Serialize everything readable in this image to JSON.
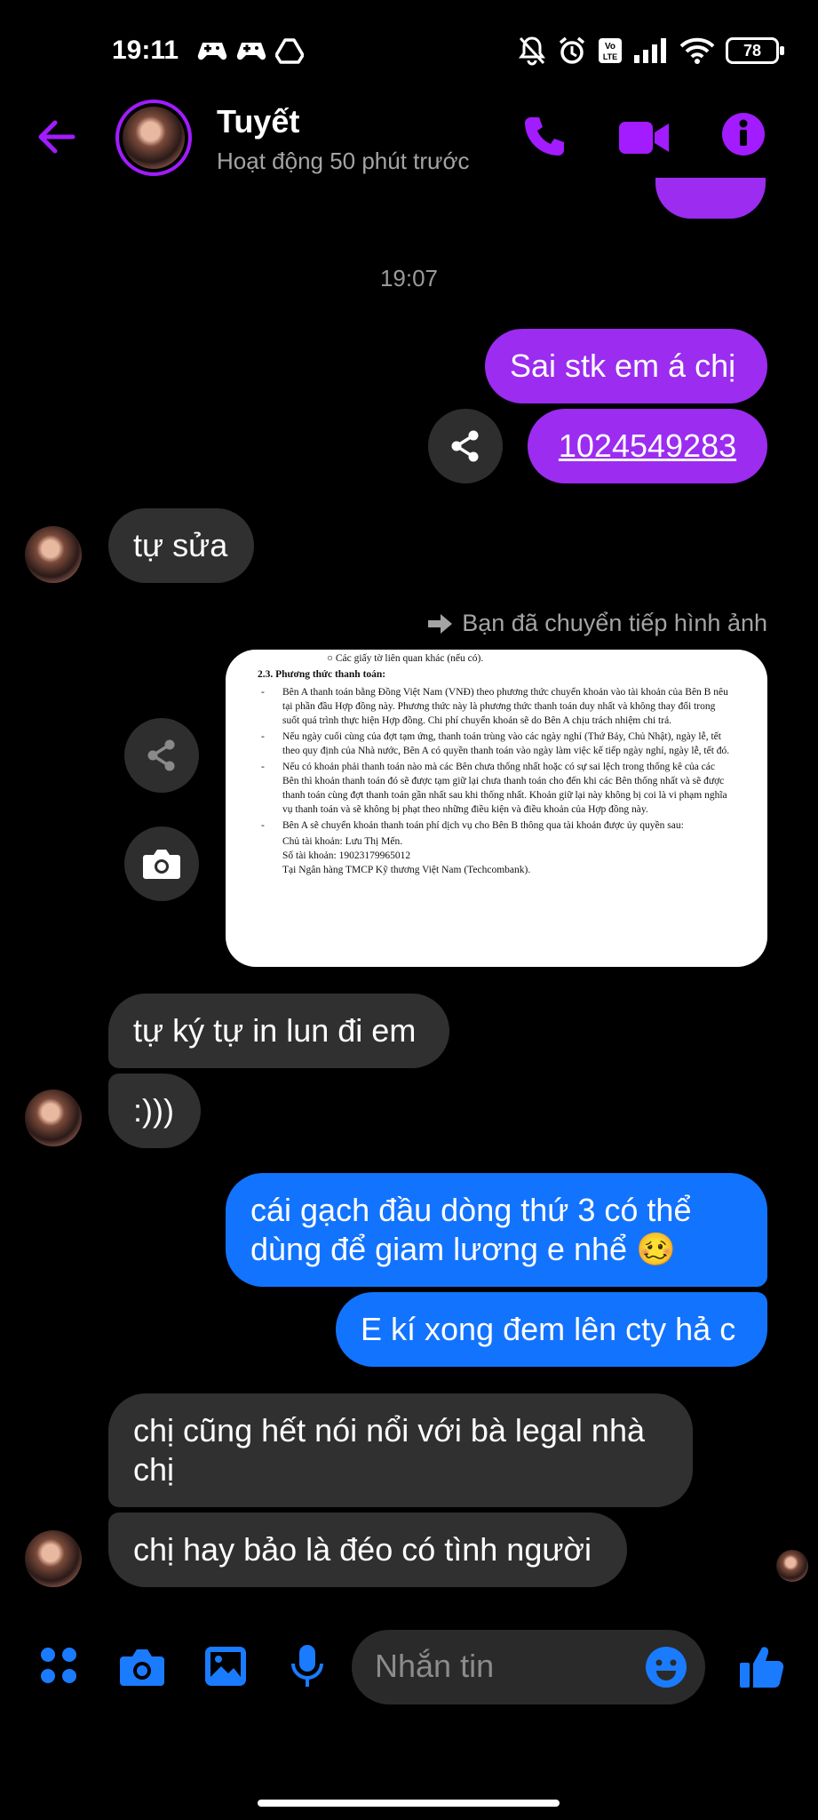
{
  "status_bar": {
    "time": "19:11",
    "battery": "78",
    "icons_left": [
      "game-controller-icon",
      "game-controller-icon",
      "drive-icon"
    ],
    "icons_right": [
      "bell-off-icon",
      "alarm-icon",
      "volte-icon",
      "signal-icon",
      "wifi-icon",
      "battery-icon"
    ]
  },
  "header": {
    "name": "Tuyết",
    "activity": "Hoạt động 50 phút trước",
    "accent": "#a21cff"
  },
  "chat": {
    "timestamp": "19:07",
    "messages": [
      {
        "side": "me",
        "text": "Sai stk em á chị"
      },
      {
        "side": "me",
        "text": "1024549283",
        "link": true
      },
      {
        "side": "them",
        "text": "tự sửa"
      },
      {
        "side": "me",
        "note": "Bạn đã chuyển tiếp hình ảnh"
      },
      {
        "side": "them",
        "text": "tự ký tự in lun đi em"
      },
      {
        "side": "them",
        "text": ":)))"
      },
      {
        "side": "me",
        "text": "cái gạch đầu dòng thứ 3 có thể dùng để giam lương e nhể 🥴"
      },
      {
        "side": "me",
        "text": "E kí xong đem lên cty hả c"
      },
      {
        "side": "them",
        "text": "chị cũng hết nói nổi với bà legal nhà chị"
      },
      {
        "side": "them",
        "text": "chị hay bảo là đéo có tình người"
      }
    ],
    "forwarded_image": {
      "top_line": "○   Các giấy tờ liên quan khác (nếu có).",
      "section": "2.3.   Phương thức thanh toán:",
      "bullets": [
        "Bên A thanh toán bằng Đồng Việt Nam (VNĐ) theo phương thức chuyển khoản vào tài khoản của Bên B nêu tại phần đầu Hợp đồng này. Phương thức này là phương thức thanh toán duy nhất và không thay đổi trong suốt quá trình thực hiện Hợp đồng. Chi phí chuyển khoản sẽ do Bên A chịu trách nhiệm chi trả.",
        "Nếu ngày cuối cùng của đợt tạm ứng, thanh toán trùng vào các ngày nghỉ (Thứ Bảy, Chủ Nhật), ngày lễ, tết theo quy định của Nhà nước, Bên A có quyền thanh toán vào ngày làm việc kế tiếp ngày nghỉ, ngày lễ, tết đó.",
        "Nếu có khoản phải thanh toán nào mà các Bên chưa thống nhất hoặc có sự sai lệch trong thống kê của các Bên thì khoản thanh toán đó sẽ được tạm giữ lại chưa thanh toán cho đến khi các Bên thống nhất và sẽ được thanh toán cùng đợt thanh toán gần nhất sau khi thống nhất. Khoản giữ lại này không bị coi là vi phạm nghĩa vụ thanh toán và sẽ không bị phạt theo những điều kiện và điều khoản của Hợp đồng này.",
        "Bên A sẽ chuyển khoản thanh toán phí dịch vụ cho Bên B thông qua tài khoản được ủy quyền sau:"
      ],
      "account_lines": [
        "Chủ tài khoản: Lưu Thị Mến.",
        "Số tài khoản: 19023179965012",
        "Tại Ngân hàng TMCP Kỹ thương Việt Nam (Techcombank)."
      ]
    }
  },
  "composer": {
    "placeholder": "Nhắn tin",
    "blue": "#1a7bff"
  }
}
